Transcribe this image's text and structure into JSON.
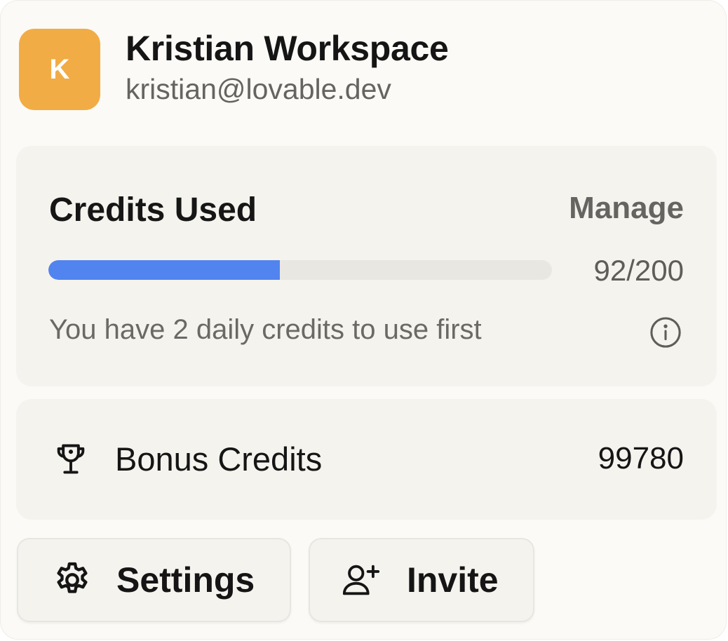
{
  "workspace": {
    "avatar_letter": "K",
    "avatar_color": "#f2ac45",
    "name": "Kristian Workspace",
    "email": "kristian@lovable.dev"
  },
  "credits": {
    "title": "Credits Used",
    "manage_label": "Manage",
    "used": 92,
    "total": 200,
    "progress_text": "92/200",
    "bar_fill_fraction": 0.46,
    "bar_color": "#5284f0",
    "daily_text": "You have 2 daily credits to use first",
    "info_icon": "info-circle-icon"
  },
  "bonus": {
    "icon": "trophy-icon",
    "label": "Bonus Credits",
    "value": "99780"
  },
  "actions": {
    "settings": {
      "icon": "gear-icon",
      "label": "Settings"
    },
    "invite": {
      "icon": "user-plus-icon",
      "label": "Invite"
    }
  }
}
